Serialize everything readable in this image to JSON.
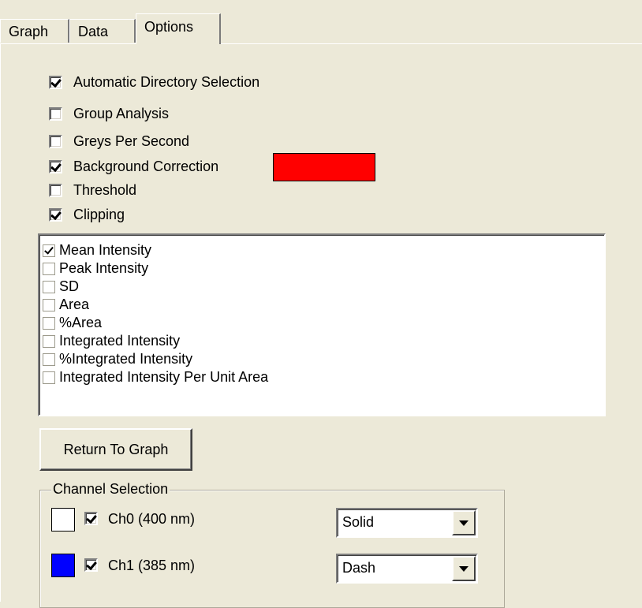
{
  "tabs": [
    {
      "label": "Graph"
    },
    {
      "label": "Data"
    },
    {
      "label": "Options"
    }
  ],
  "active_tab": "Options",
  "options": [
    {
      "label": "Automatic Directory Selection",
      "checked": true
    },
    {
      "label": "Group Analysis",
      "checked": false
    },
    {
      "label": "Greys Per Second",
      "checked": false
    },
    {
      "label": "Background Correction",
      "checked": true
    },
    {
      "label": "Threshold",
      "checked": false
    },
    {
      "label": "Clipping",
      "checked": true
    }
  ],
  "background_correction_color": "#ff0000",
  "measurements": [
    {
      "label": "Mean Intensity",
      "checked": true
    },
    {
      "label": "Peak Intensity",
      "checked": false
    },
    {
      "label": "SD",
      "checked": false
    },
    {
      "label": "Area",
      "checked": false
    },
    {
      "label": "%Area",
      "checked": false
    },
    {
      "label": "Integrated Intensity",
      "checked": false
    },
    {
      "label": "%Integrated Intensity",
      "checked": false
    },
    {
      "label": "Integrated Intensity Per Unit Area",
      "checked": false
    }
  ],
  "return_button": {
    "label": "Return To Graph"
  },
  "channel_selection": {
    "title": "Channel Selection",
    "channels": [
      {
        "label": "Ch0 (400 nm)",
        "checked": true,
        "color": "#ffffff",
        "line_style": "Solid"
      },
      {
        "label": "Ch1 (385 nm)",
        "checked": true,
        "color": "#0000ff",
        "line_style": "Dash"
      }
    ]
  }
}
